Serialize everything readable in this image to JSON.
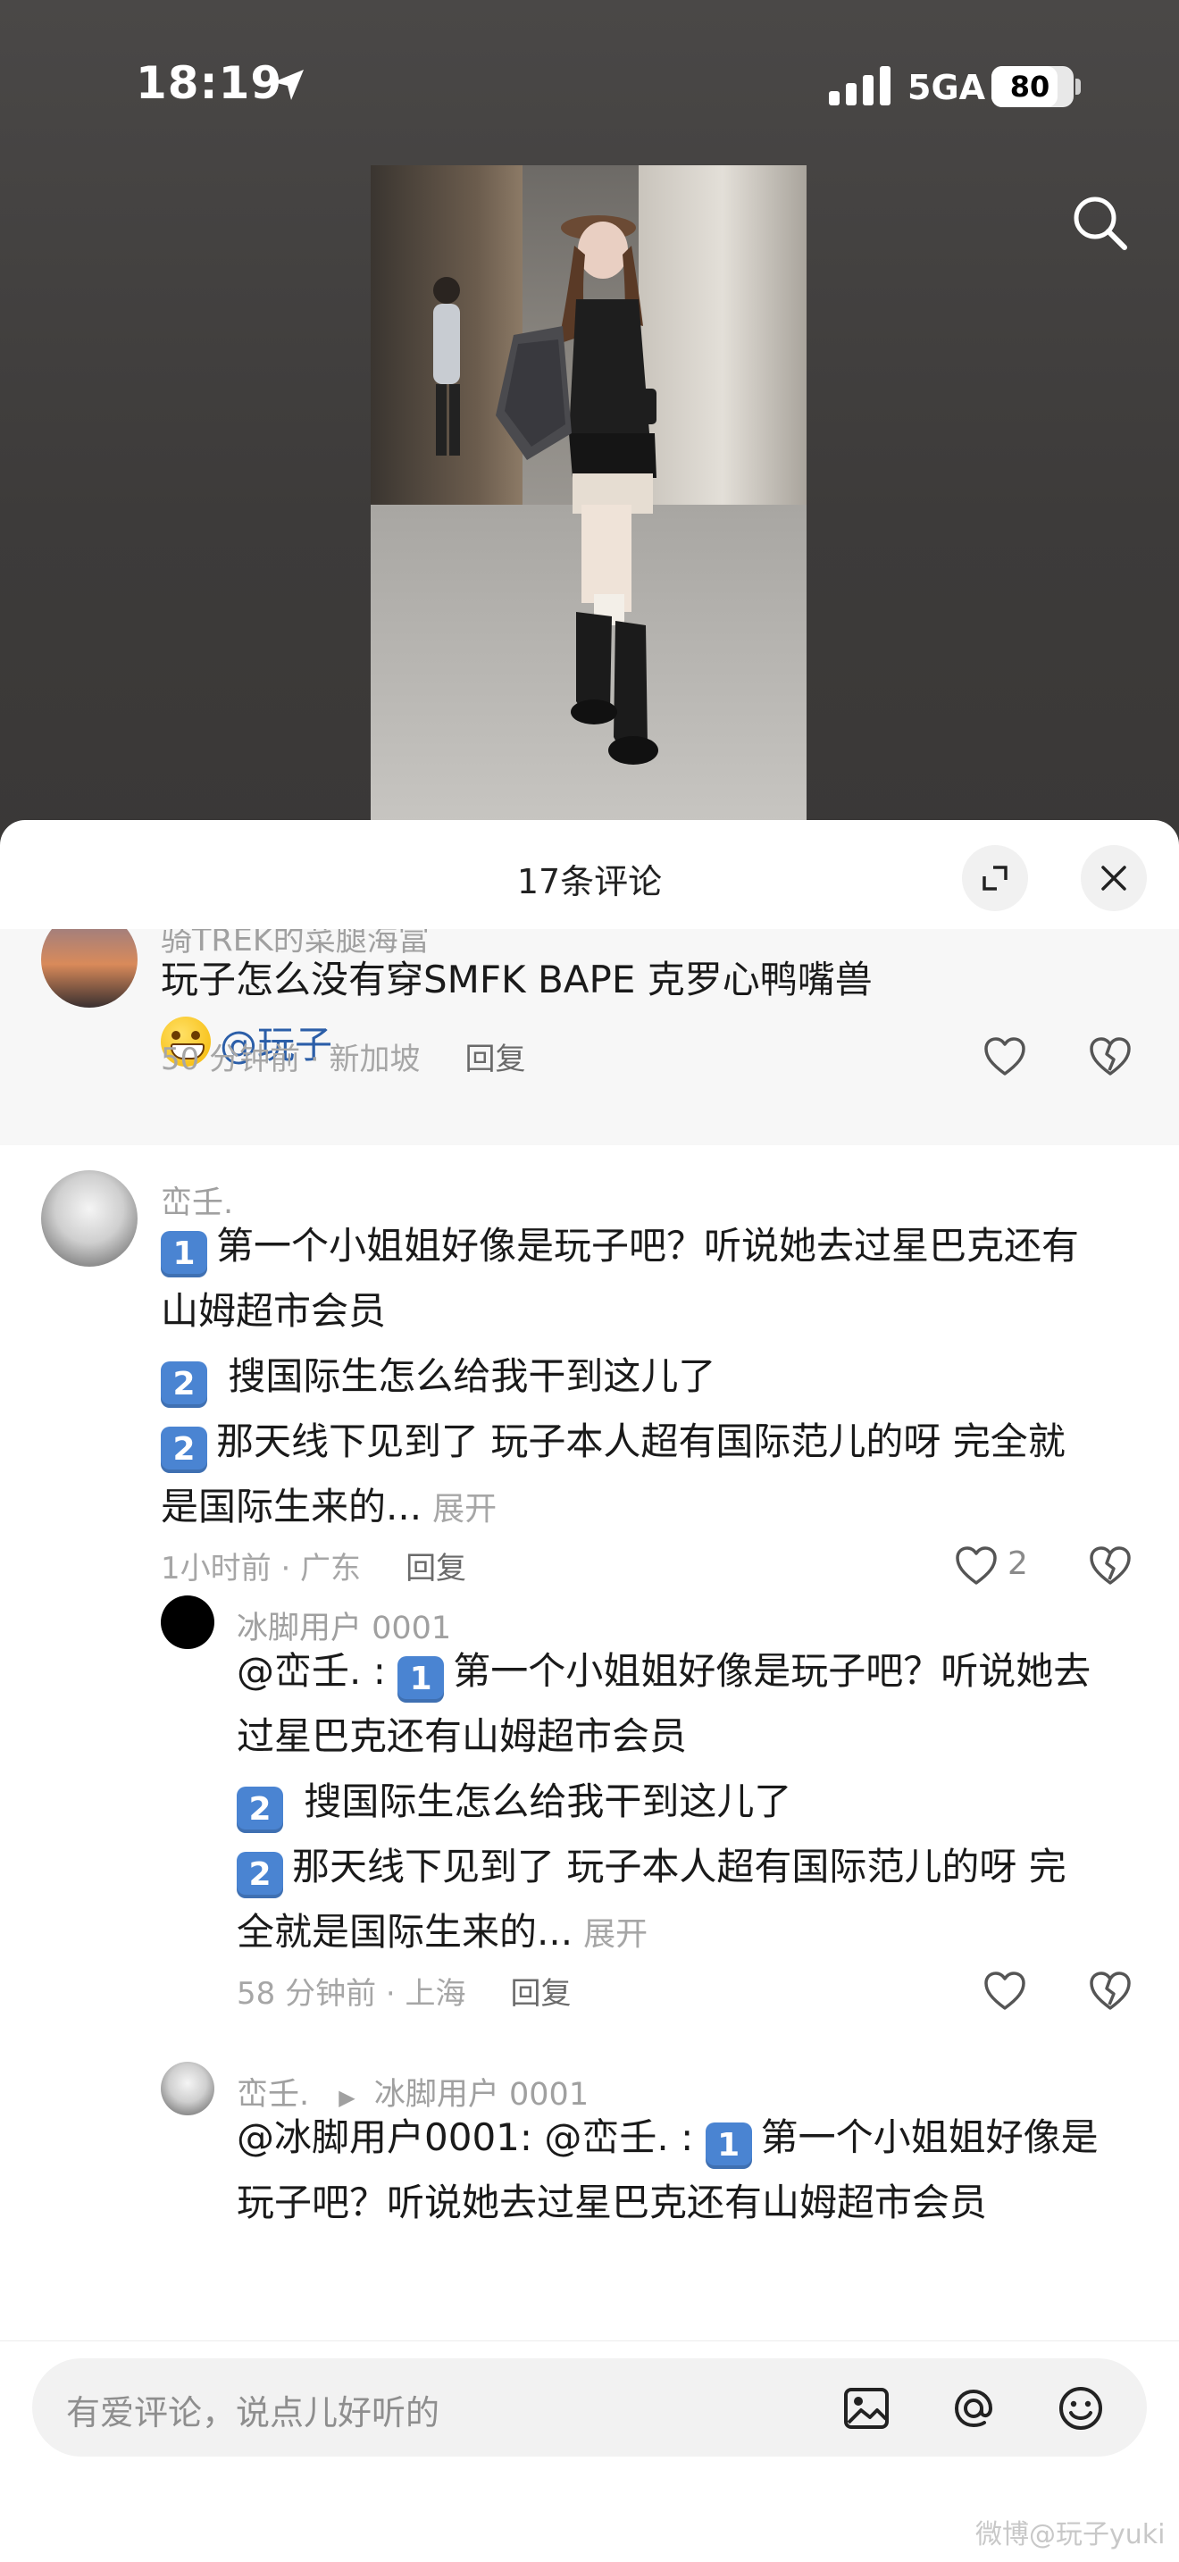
{
  "status_bar": {
    "time": "18:19",
    "network": "5GA",
    "battery": "80",
    "battery_level": 0.8
  },
  "sheet": {
    "title": "17条评论"
  },
  "comments": [
    {
      "username": "骑TREK的菜腿海富",
      "text_line1": "玩子怎么没有穿SMFK BAPE 克罗心鸭嘴兽",
      "mention": "@玩子",
      "time_location": "50 分钟前 · 新加坡",
      "reply": "回复"
    },
    {
      "username": "峦壬.",
      "item1_badge": "1",
      "item1_text": "第一个小姐姐好像是玩子吧？听说她去过星巴克还有",
      "item1_cont": "山姆超市会员",
      "item2_badge": "2",
      "item2_text": " 搜国际生怎么给我干到这儿了",
      "item3_badge": "2",
      "item3_text": "那天线下见到了 玩子本人超有国际范儿的呀 完全就",
      "item3_cont": "是国际生来的...",
      "expand": "展开",
      "time_location": "1小时前 · 广东",
      "reply": "回复",
      "likes": "2"
    },
    {
      "username": "冰脚用户 0001",
      "prefix": "@峦壬. : ",
      "item1_badge": "1",
      "item1_text": "第一个小姐姐好像是玩子吧？听说她去",
      "item1_cont": "过星巴克还有山姆超市会员",
      "item2_badge": "2",
      "item2_text": " 搜国际生怎么给我干到这儿了",
      "item3_badge": "2",
      "item3_text": "那天线下见到了 玩子本人超有国际范儿的呀 完",
      "item3_cont": "全就是国际生来的...",
      "expand": "展开",
      "time_location": "58 分钟前 · 上海",
      "reply": "回复"
    },
    {
      "username": "峦壬.",
      "reply_to": "冰脚用户 0001",
      "prefix": "@冰脚用户0001: @峦壬. : ",
      "item1_badge": "1",
      "item1_text": "第一个小姐姐好像是",
      "item1_cont": "玩子吧？听说她去过星巴克还有山姆超市会员"
    }
  ],
  "input": {
    "placeholder": "有爱评论，说点儿好听的"
  },
  "watermark": "微博@玩子yuki",
  "colors": {
    "accent_mention": "#2b5ea8",
    "badge_blue": "#4a84d2",
    "meta_gray": "#a6a6a6"
  },
  "icons": [
    "location-arrow-icon",
    "signal-icon",
    "search-icon",
    "expand-icon",
    "close-icon",
    "heart-icon",
    "broken-heart-icon",
    "image-icon",
    "at-icon",
    "emoji-icon"
  ]
}
